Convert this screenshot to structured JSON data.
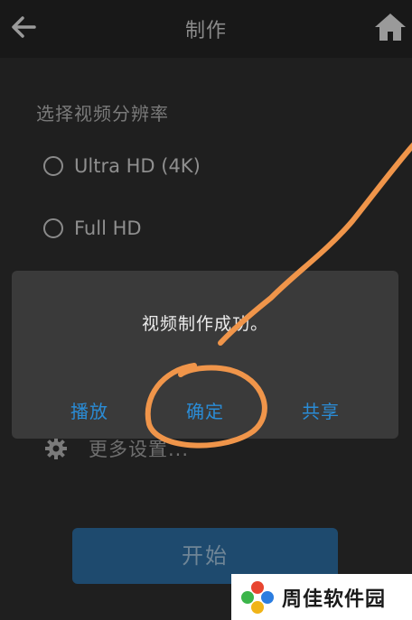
{
  "header": {
    "title": "制作",
    "back_icon": "arrow-left-icon",
    "home_icon": "home-icon"
  },
  "resolution": {
    "section_title": "选择视频分辨率",
    "options": [
      {
        "label": "Ultra HD (4K)",
        "selected": false
      },
      {
        "label": "Full HD",
        "selected": false
      }
    ]
  },
  "settings": {
    "label": "更多设置...",
    "icon": "gear-icon"
  },
  "start_button": {
    "label": "开始"
  },
  "dialog": {
    "message": "视频制作成功。",
    "buttons": {
      "play": "播放",
      "ok": "确定",
      "share": "共享"
    }
  },
  "watermark": {
    "text": "周佳软件园"
  },
  "colors": {
    "background": "#1f1f1f",
    "dialog_bg": "#3a3a3a",
    "accent": "#2a8cd6",
    "annotation": "#f0954a"
  }
}
